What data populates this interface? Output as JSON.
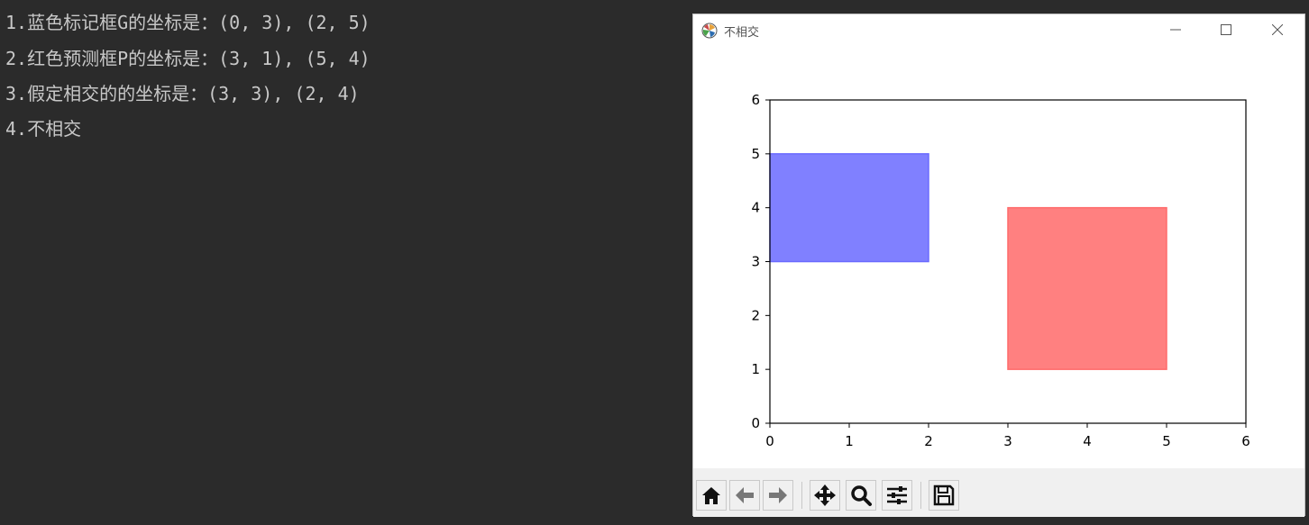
{
  "console": {
    "lines": [
      "1.蓝色标记框G的坐标是：(0, 3), (2, 5)",
      "2.红色预测框P的坐标是：(3, 1), (5, 4)",
      "3.假定相交的的坐标是：(3, 3), (2, 4)",
      "4.不相交"
    ]
  },
  "window": {
    "title": "不相交",
    "minimize_icon": "minimize-icon",
    "maximize_icon": "maximize-icon",
    "close_icon": "close-icon"
  },
  "toolbar": {
    "buttons": [
      "home-icon",
      "back-icon",
      "forward-icon",
      "pan-icon",
      "zoom-icon",
      "configure-subplots-icon",
      "save-icon"
    ]
  },
  "chart_data": {
    "type": "rectangles",
    "xlim": [
      0,
      6
    ],
    "ylim": [
      0,
      6
    ],
    "x_ticks": [
      "0",
      "1",
      "2",
      "3",
      "4",
      "5",
      "6"
    ],
    "y_ticks": [
      "0",
      "1",
      "2",
      "3",
      "4",
      "5",
      "6"
    ],
    "grid": false,
    "rectangles": [
      {
        "x0": 0,
        "y0": 3,
        "x1": 2,
        "y1": 5,
        "color": "#8080ff",
        "edge": "#6b6bff"
      },
      {
        "x0": 3,
        "y0": 1,
        "x1": 5,
        "y1": 4,
        "color": "#ff8080",
        "edge": "#ff6b6b"
      }
    ]
  }
}
